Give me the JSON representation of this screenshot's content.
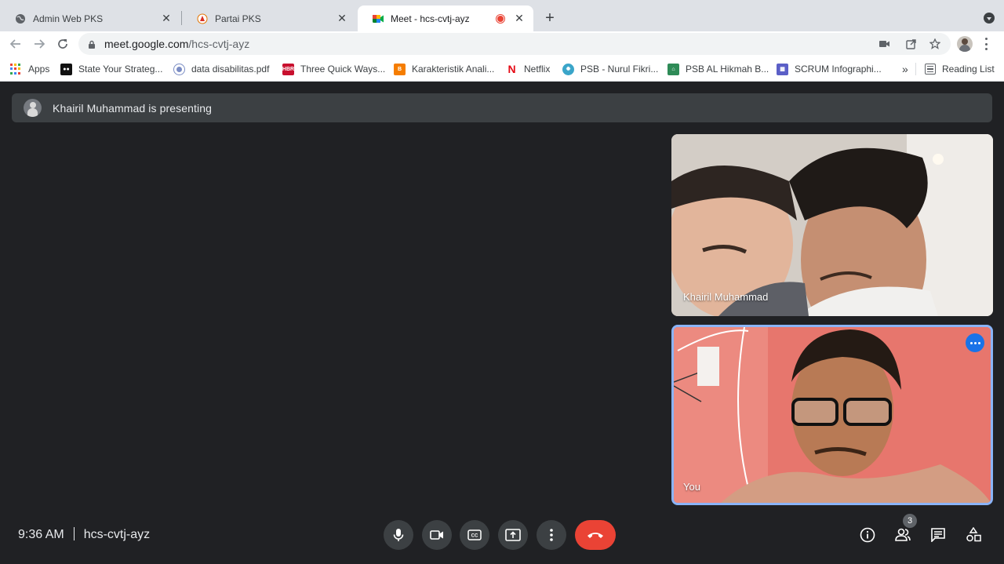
{
  "browser": {
    "tabs": [
      {
        "title": "Admin Web PKS",
        "icon": "globe-icon",
        "active": false
      },
      {
        "title": "Partai PKS",
        "icon": "pks-logo-icon",
        "active": false
      },
      {
        "title": "Meet - hcs-cvtj-ayz",
        "icon": "google-meet-icon",
        "active": true,
        "recording": true
      }
    ],
    "url_host": "meet.google.com",
    "url_path": "/hcs-cvtj-ayz",
    "bookmarks": [
      {
        "label": "Apps",
        "icon": "apps-grid-icon"
      },
      {
        "label": "State Your Strateg...",
        "icon": "bookmark-dots-icon"
      },
      {
        "label": "data disabilitas.pdf",
        "icon": "globe-icon"
      },
      {
        "label": "Three Quick Ways...",
        "icon": "hbr-icon"
      },
      {
        "label": "Karakteristik Anali...",
        "icon": "blogger-icon"
      },
      {
        "label": "Netflix",
        "icon": "netflix-icon"
      },
      {
        "label": "PSB - Nurul Fikri...",
        "icon": "psb-icon"
      },
      {
        "label": "PSB AL Hikmah B...",
        "icon": "school-icon"
      },
      {
        "label": "SCRUM Infographi...",
        "icon": "infographic-icon"
      }
    ],
    "bookmarks_overflow": "»",
    "reading_list": "Reading List"
  },
  "meet": {
    "presenting_text": "Khairil Muhammad is presenting",
    "participants": [
      {
        "name": "Khairil Muhammad"
      },
      {
        "name": "You"
      }
    ],
    "time": "9:36 AM",
    "meeting_code": "hcs-cvtj-ayz",
    "participant_count": "3"
  },
  "colors": {
    "background": "#202124",
    "end_call": "#ea4335",
    "active_tile_border": "#8ab4f8",
    "recording": "#ea4335"
  }
}
